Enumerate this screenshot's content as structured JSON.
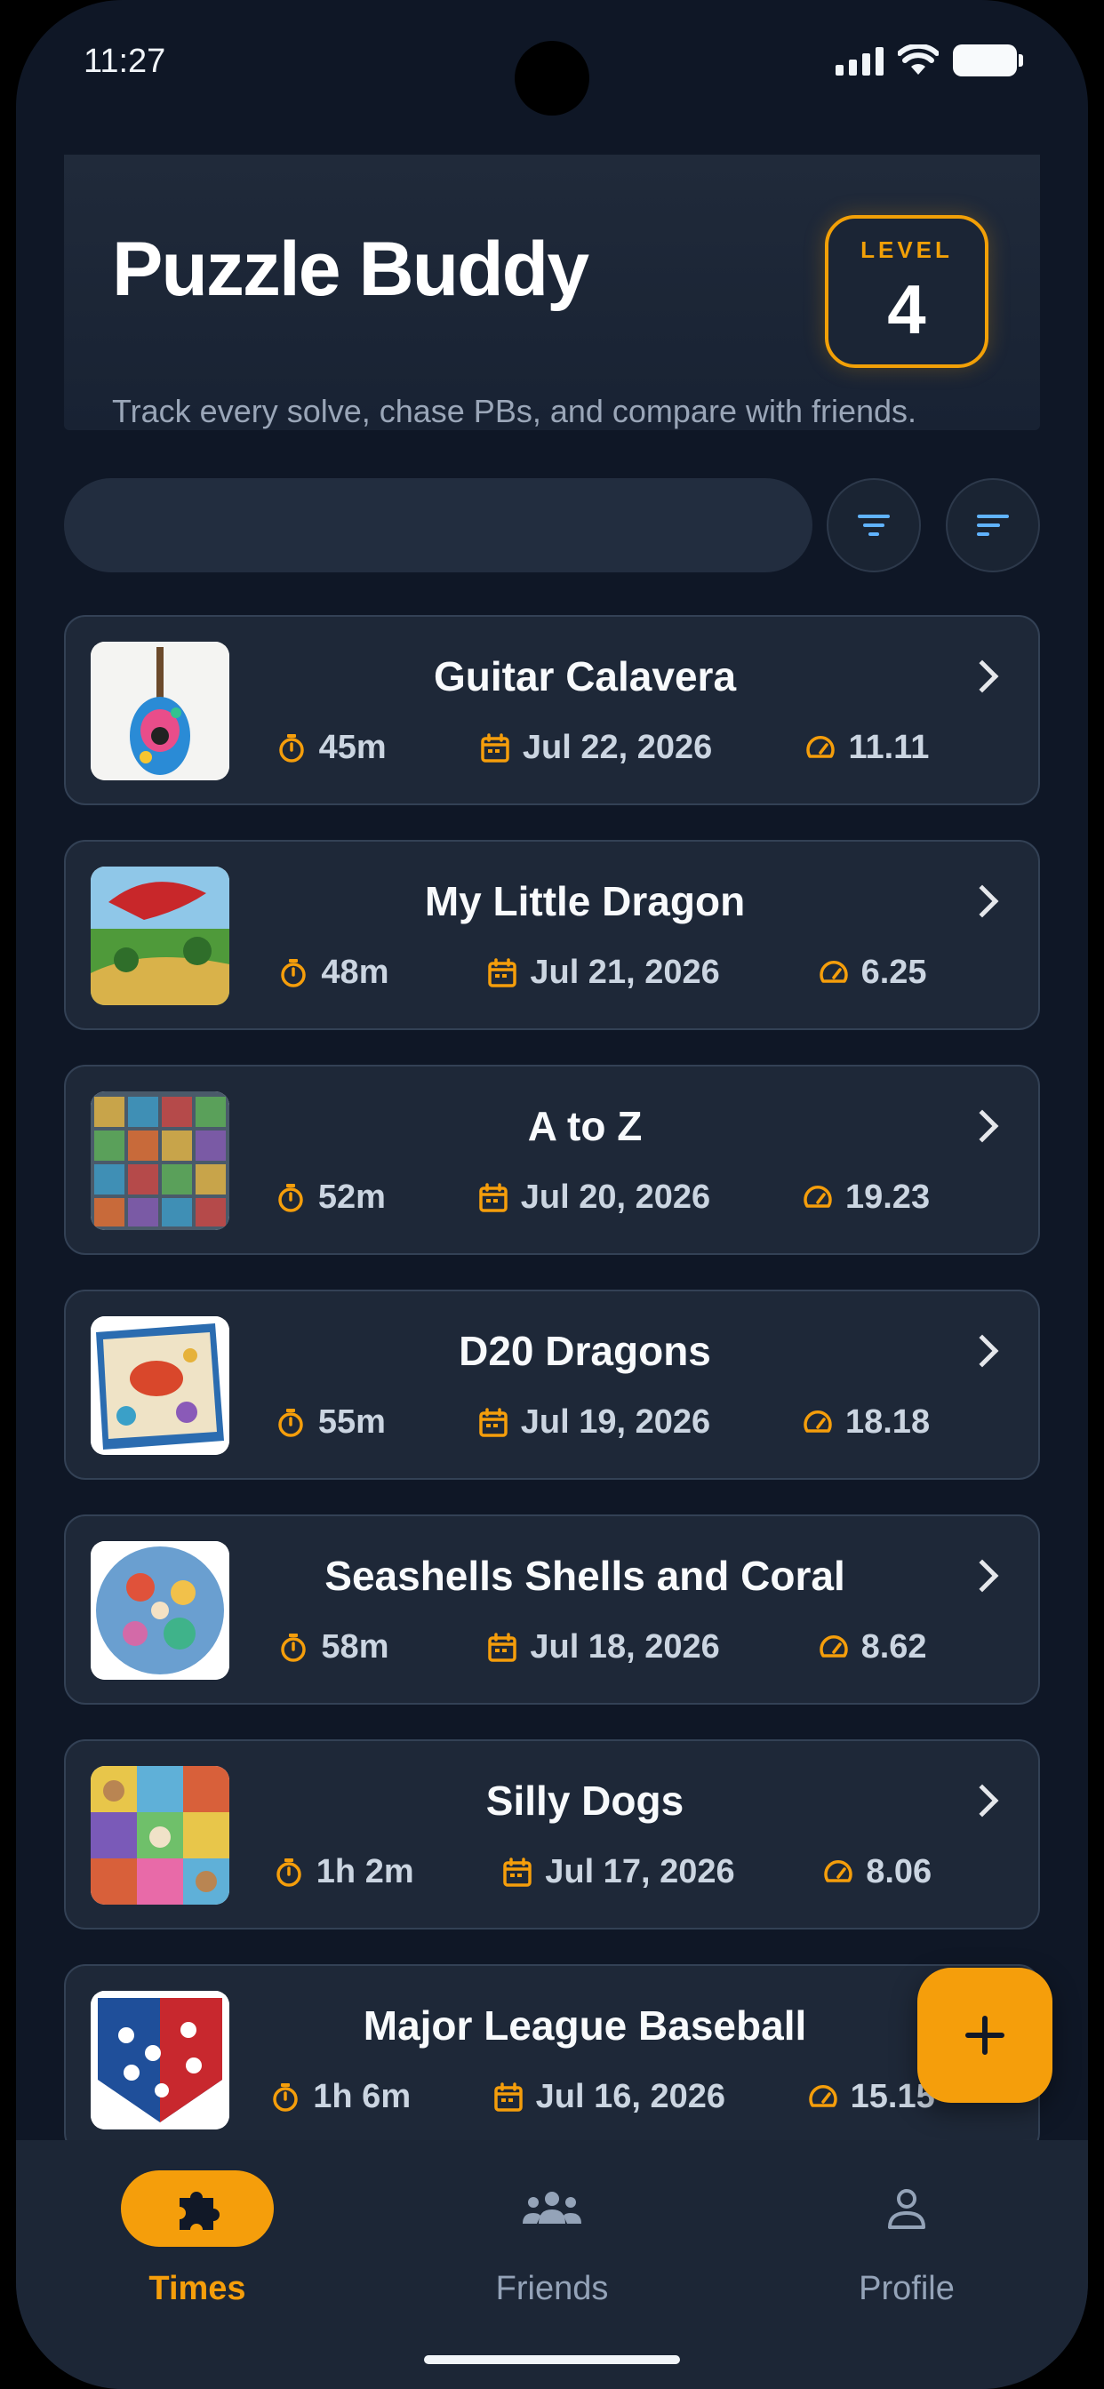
{
  "status_bar": {
    "time": "11:27"
  },
  "header": {
    "title": "Puzzle Buddy",
    "tagline": "Track every solve, chase PBs, and compare with friends.",
    "level_label": "LEVEL",
    "level_value": "4"
  },
  "search": {
    "placeholder": ""
  },
  "toolbar": {
    "filter_icon": "filter-icon",
    "sort_icon": "sort-icon"
  },
  "colors": {
    "accent": "#f59e0b",
    "background": "#0f1726",
    "card": "#1e2838",
    "info_icon": "#60b3ff"
  },
  "puzzles": [
    {
      "title": "Guitar Calavera",
      "time": "45m",
      "date": "Jul 22, 2026",
      "speed": "11.11"
    },
    {
      "title": "My Little Dragon",
      "time": "48m",
      "date": "Jul 21, 2026",
      "speed": "6.25"
    },
    {
      "title": "A to Z",
      "time": "52m",
      "date": "Jul 20, 2026",
      "speed": "19.23"
    },
    {
      "title": "D20 Dragons",
      "time": "55m",
      "date": "Jul 19, 2026",
      "speed": "18.18"
    },
    {
      "title": "Seashells Shells and Coral",
      "time": "58m",
      "date": "Jul 18, 2026",
      "speed": "8.62"
    },
    {
      "title": "Silly Dogs",
      "time": "1h 2m",
      "date": "Jul 17, 2026",
      "speed": "8.06"
    },
    {
      "title": "Major League Baseball",
      "time": "1h 6m",
      "date": "Jul 16, 2026",
      "speed": "15.15"
    }
  ],
  "fab": {
    "icon": "plus-icon"
  },
  "nav": {
    "times": "Times",
    "friends": "Friends",
    "profile": "Profile"
  }
}
